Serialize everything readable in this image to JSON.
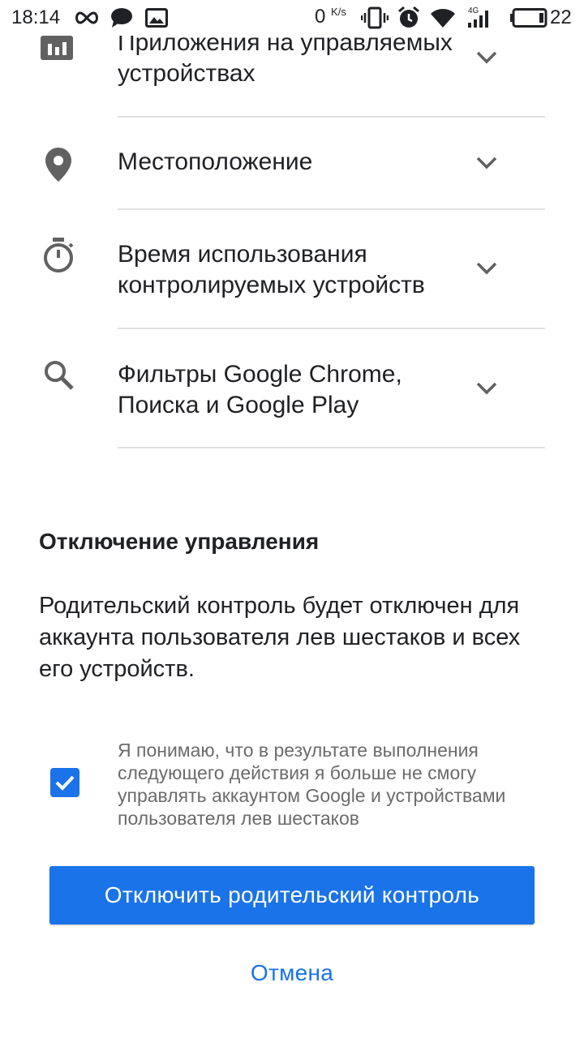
{
  "status_bar": {
    "time": "18:14",
    "speed_value": "0",
    "speed_unit": "K/s",
    "network": "4G",
    "battery": "22",
    "icons": [
      "infinity-icon",
      "message-icon",
      "image-icon",
      "vibrate-icon",
      "alarm-icon",
      "wifi-icon",
      "signal-icon",
      "battery-icon"
    ]
  },
  "settings_list": [
    {
      "icon": "bar-chart-icon",
      "label": "Приложения на управляемых устройствах"
    },
    {
      "icon": "location-pin-icon",
      "label": "Местоположение"
    },
    {
      "icon": "timer-icon",
      "label": "Время использования контролируемых устройств"
    },
    {
      "icon": "search-icon",
      "label": "Фильтры Google Chrome, Поиска и Google Play"
    }
  ],
  "disable_section": {
    "title": "Отключение управления",
    "body": "Родительский контроль будет отключен для аккаунта пользователя лев шестаков и всех его устройств.",
    "consent_checked": true,
    "consent_text": "Я понимаю, что в результате выполнения следующего действия я больше не смогу управлять аккаунтом Google и устройствами пользователя лев шестаков",
    "primary_button": "Отключить родительский контроль",
    "cancel_button": "Отмена"
  },
  "colors": {
    "accent": "#1a73e8",
    "text": "#202124",
    "secondary_text": "#6b6b6b",
    "icon": "#616161",
    "divider": "#e0e0e0"
  }
}
